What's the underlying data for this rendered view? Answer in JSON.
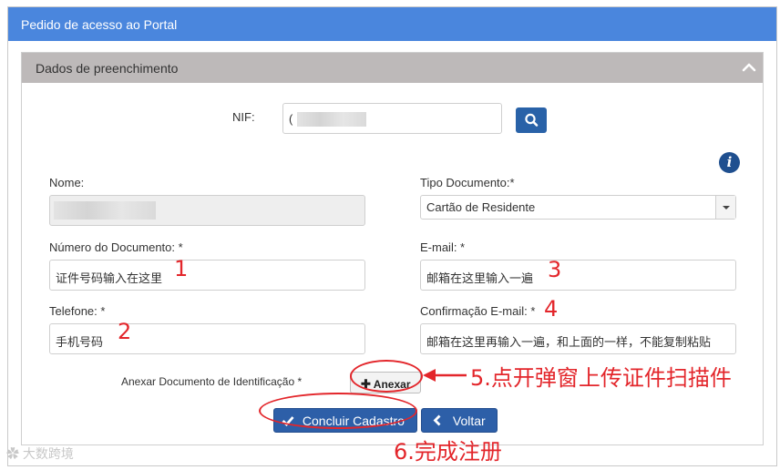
{
  "header": {
    "title": "Pedido de acesso ao Portal"
  },
  "panel": {
    "title": "Dados de preenchimento"
  },
  "nif": {
    "label": "NIF:",
    "value": "("
  },
  "form": {
    "nome_label": "Nome:",
    "tipo_label": "Tipo Documento:*",
    "tipo_value": "Cartão de Residente",
    "numero_label": "Número do Documento: *",
    "numero_value": "证件号码输入在这里",
    "email_label": "E-mail: *",
    "email_value": "邮箱在这里输入一遍",
    "telefone_label": "Telefone: *",
    "telefone_value": "手机号码",
    "confirm_label": "Confirmação E-mail: *",
    "confirm_value": "邮箱在这里再输入一遍，和上面的一样，不能复制粘贴",
    "anexar_label": "Anexar Documento de Identificação *",
    "anexar_button": "Anexar",
    "concluir_button": "Concluir Cadastro",
    "voltar_button": "Voltar"
  },
  "annotations": {
    "n1": "1",
    "n2": "2",
    "n3": "3",
    "n4": "4",
    "step5": "5.点开弹窗上传证件扫描件",
    "step6": "6.完成注册"
  },
  "watermark": "大数跨境",
  "colors": {
    "header": "#4a86dd",
    "panel_head": "#bdb9b9",
    "button": "#2d5fa8",
    "annotation": "#e3262b"
  }
}
